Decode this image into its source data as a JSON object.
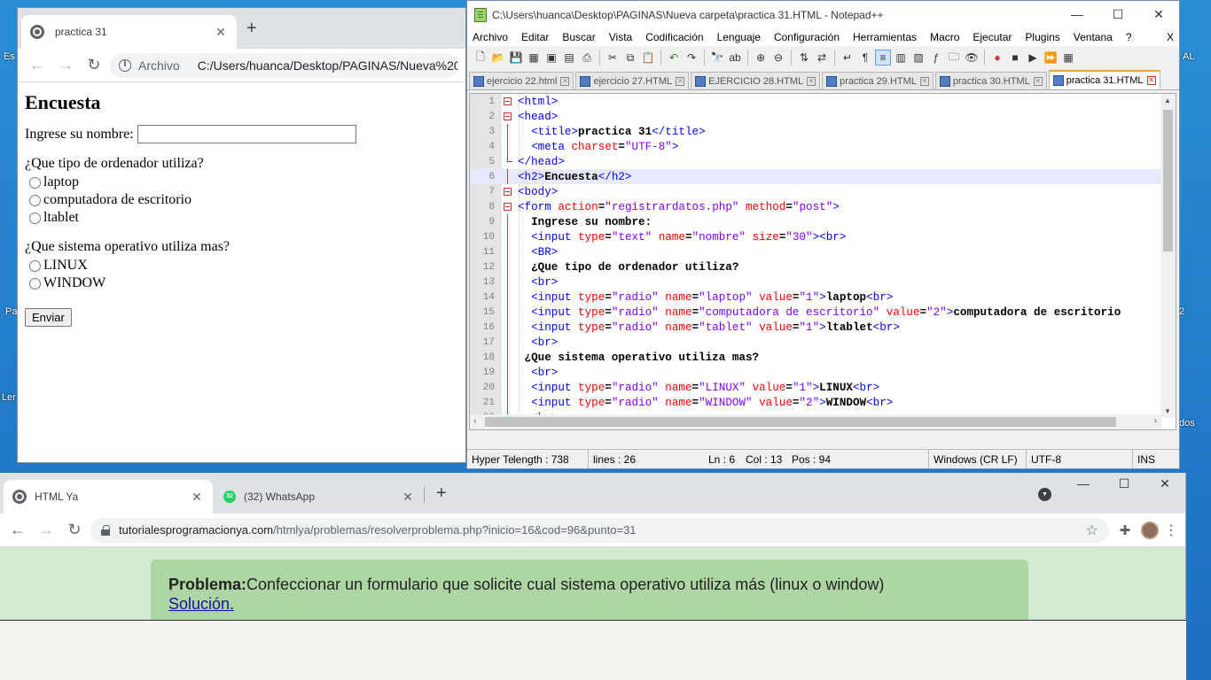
{
  "desktop": {
    "fragments": [
      "Es",
      "Pa",
      "Ler",
      "AL",
      "2",
      "dos"
    ]
  },
  "chrome1": {
    "tab_title": "practica 31",
    "new_tab": "+",
    "address_scheme": "Archivo",
    "address_url": "C:/Users/huanca/Desktop/PAGINAS/Nueva%20c",
    "page": {
      "heading": "Encuesta",
      "name_label": "Ingrese su nombre:",
      "q1": "¿Que tipo de ordenador utiliza?",
      "q1_options": [
        "laptop",
        "computadora de escritorio",
        "ltablet"
      ],
      "q2": "¿Que sistema operativo utiliza mas?",
      "q2_options": [
        "LINUX",
        "WINDOW"
      ],
      "submit": "Enviar"
    }
  },
  "npp": {
    "title": "C:\\Users\\huanca\\Desktop\\PAGINAS\\Nueva carpeta\\practica 31.HTML - Notepad++",
    "menu": [
      "Archivo",
      "Editar",
      "Buscar",
      "Vista",
      "Codificación",
      "Lenguaje",
      "Configuración",
      "Herramientas",
      "Macro",
      "Ejecutar",
      "Plugins",
      "Ventana",
      "?"
    ],
    "menu_close": "X",
    "tabs": [
      "ejercicio 22.html",
      "ejercicio 27.HTML",
      "EJERCICIO 28.HTML",
      "practica 29.HTML",
      "practica 30.HTML",
      "practica 31.HTML"
    ],
    "active_tab": 5,
    "current_line": 6,
    "code": [
      [
        [
          "tag",
          "<html>"
        ]
      ],
      [
        [
          "tag",
          "<head>"
        ]
      ],
      [
        [
          "txt",
          "  "
        ],
        [
          "tag",
          "<title>"
        ],
        [
          "txt",
          "practica 31"
        ],
        [
          "tag",
          "</title>"
        ]
      ],
      [
        [
          "txt",
          "  "
        ],
        [
          "tag",
          "<meta "
        ],
        [
          "attr",
          "charset"
        ],
        [
          "txt",
          "="
        ],
        [
          "val",
          "\"UTF-8\""
        ],
        [
          "tag",
          ">"
        ]
      ],
      [
        [
          "tag",
          "</head>"
        ]
      ],
      [
        [
          "tag",
          "<h2>"
        ],
        [
          "txt",
          "Encuesta"
        ],
        [
          "tag",
          "</h2>"
        ]
      ],
      [
        [
          "tag",
          "<body>"
        ]
      ],
      [
        [
          "tag",
          "<form "
        ],
        [
          "attr",
          "action"
        ],
        [
          "txt",
          "="
        ],
        [
          "val",
          "\"registrardatos.php\""
        ],
        [
          "txt",
          " "
        ],
        [
          "attr",
          "method"
        ],
        [
          "txt",
          "="
        ],
        [
          "val",
          "\"post\""
        ],
        [
          "tag",
          ">"
        ]
      ],
      [
        [
          "txt",
          "  Ingrese su nombre:"
        ]
      ],
      [
        [
          "txt",
          "  "
        ],
        [
          "tag",
          "<input "
        ],
        [
          "attr",
          "type"
        ],
        [
          "txt",
          "="
        ],
        [
          "val",
          "\"text\""
        ],
        [
          "txt",
          " "
        ],
        [
          "attr",
          "name"
        ],
        [
          "txt",
          "="
        ],
        [
          "val",
          "\"nombre\""
        ],
        [
          "txt",
          " "
        ],
        [
          "attr",
          "size"
        ],
        [
          "txt",
          "="
        ],
        [
          "val",
          "\"30\""
        ],
        [
          "tag",
          "><br>"
        ]
      ],
      [
        [
          "txt",
          "  "
        ],
        [
          "tag",
          "<BR>"
        ]
      ],
      [
        [
          "txt",
          "  ¿Que tipo de ordenador utiliza?"
        ]
      ],
      [
        [
          "txt",
          "  "
        ],
        [
          "tag",
          "<br>"
        ]
      ],
      [
        [
          "txt",
          "  "
        ],
        [
          "tag",
          "<input "
        ],
        [
          "attr",
          "type"
        ],
        [
          "txt",
          "="
        ],
        [
          "val",
          "\"radio\""
        ],
        [
          "txt",
          " "
        ],
        [
          "attr",
          "name"
        ],
        [
          "txt",
          "="
        ],
        [
          "val",
          "\"laptop\""
        ],
        [
          "txt",
          " "
        ],
        [
          "attr",
          "value"
        ],
        [
          "txt",
          "="
        ],
        [
          "val",
          "\"1\""
        ],
        [
          "tag",
          ">"
        ],
        [
          "txt",
          "laptop"
        ],
        [
          "tag",
          "<br>"
        ]
      ],
      [
        [
          "txt",
          "  "
        ],
        [
          "tag",
          "<input "
        ],
        [
          "attr",
          "type"
        ],
        [
          "txt",
          "="
        ],
        [
          "val",
          "\"radio\""
        ],
        [
          "txt",
          " "
        ],
        [
          "attr",
          "name"
        ],
        [
          "txt",
          "="
        ],
        [
          "val",
          "\"computadora de escritorio\""
        ],
        [
          "txt",
          " "
        ],
        [
          "attr",
          "value"
        ],
        [
          "txt",
          "="
        ],
        [
          "val",
          "\"2\""
        ],
        [
          "tag",
          ">"
        ],
        [
          "txt",
          "computadora de escritorio"
        ]
      ],
      [
        [
          "txt",
          "  "
        ],
        [
          "tag",
          "<input "
        ],
        [
          "attr",
          "type"
        ],
        [
          "txt",
          "="
        ],
        [
          "val",
          "\"radio\""
        ],
        [
          "txt",
          " "
        ],
        [
          "attr",
          "name"
        ],
        [
          "txt",
          "="
        ],
        [
          "val",
          "\"tablet\""
        ],
        [
          "txt",
          " "
        ],
        [
          "attr",
          "value"
        ],
        [
          "txt",
          "="
        ],
        [
          "val",
          "\"1\""
        ],
        [
          "tag",
          ">"
        ],
        [
          "txt",
          "ltablet"
        ],
        [
          "tag",
          "<br>"
        ]
      ],
      [
        [
          "txt",
          "  "
        ],
        [
          "tag",
          "<br>"
        ]
      ],
      [
        [
          "txt",
          " ¿Que sistema operativo utiliza mas?"
        ]
      ],
      [
        [
          "txt",
          "  "
        ],
        [
          "tag",
          "<br>"
        ]
      ],
      [
        [
          "txt",
          "  "
        ],
        [
          "tag",
          "<input "
        ],
        [
          "attr",
          "type"
        ],
        [
          "txt",
          "="
        ],
        [
          "val",
          "\"radio\""
        ],
        [
          "txt",
          " "
        ],
        [
          "attr",
          "name"
        ],
        [
          "txt",
          "="
        ],
        [
          "val",
          "\"LINUX\""
        ],
        [
          "txt",
          " "
        ],
        [
          "attr",
          "value"
        ],
        [
          "txt",
          "="
        ],
        [
          "val",
          "\"1\""
        ],
        [
          "tag",
          ">"
        ],
        [
          "txt",
          "LINUX"
        ],
        [
          "tag",
          "<br>"
        ]
      ],
      [
        [
          "txt",
          "  "
        ],
        [
          "tag",
          "<input "
        ],
        [
          "attr",
          "type"
        ],
        [
          "txt",
          "="
        ],
        [
          "val",
          "\"radio\""
        ],
        [
          "txt",
          " "
        ],
        [
          "attr",
          "name"
        ],
        [
          "txt",
          "="
        ],
        [
          "val",
          "\"WINDOW\""
        ],
        [
          "txt",
          " "
        ],
        [
          "attr",
          "value"
        ],
        [
          "txt",
          "="
        ],
        [
          "val",
          "\"2\""
        ],
        [
          "tag",
          ">"
        ],
        [
          "txt",
          "WINDOW"
        ],
        [
          "tag",
          "<br>"
        ]
      ],
      [
        [
          "txt",
          "  "
        ],
        [
          "tag",
          "<br>"
        ]
      ]
    ],
    "status": {
      "lang": "Hyper Te",
      "length": "length : 738",
      "lines": "lines : 26",
      "ln": "Ln : 6",
      "col": "Col : 13",
      "pos": "Pos : 94",
      "eol": "Windows (CR LF)",
      "enc": "UTF-8",
      "ins": "INS"
    }
  },
  "chrome2": {
    "tabs": [
      {
        "title": "HTML Ya",
        "icon": "globe-icon"
      },
      {
        "title": "(32) WhatsApp",
        "icon": "whatsapp-icon",
        "badge": "32"
      }
    ],
    "url_host": "tutorialesprogramacionya.com",
    "url_path": "/htmlya/problemas/resolverproblema.php?inicio=16&cod=96&punto=31",
    "problem_label": "Problema:",
    "problem_text": "Confeccionar un formulario que solicite cual sistema operativo utiliza más (linux o window)",
    "solution_link": "Solución."
  }
}
